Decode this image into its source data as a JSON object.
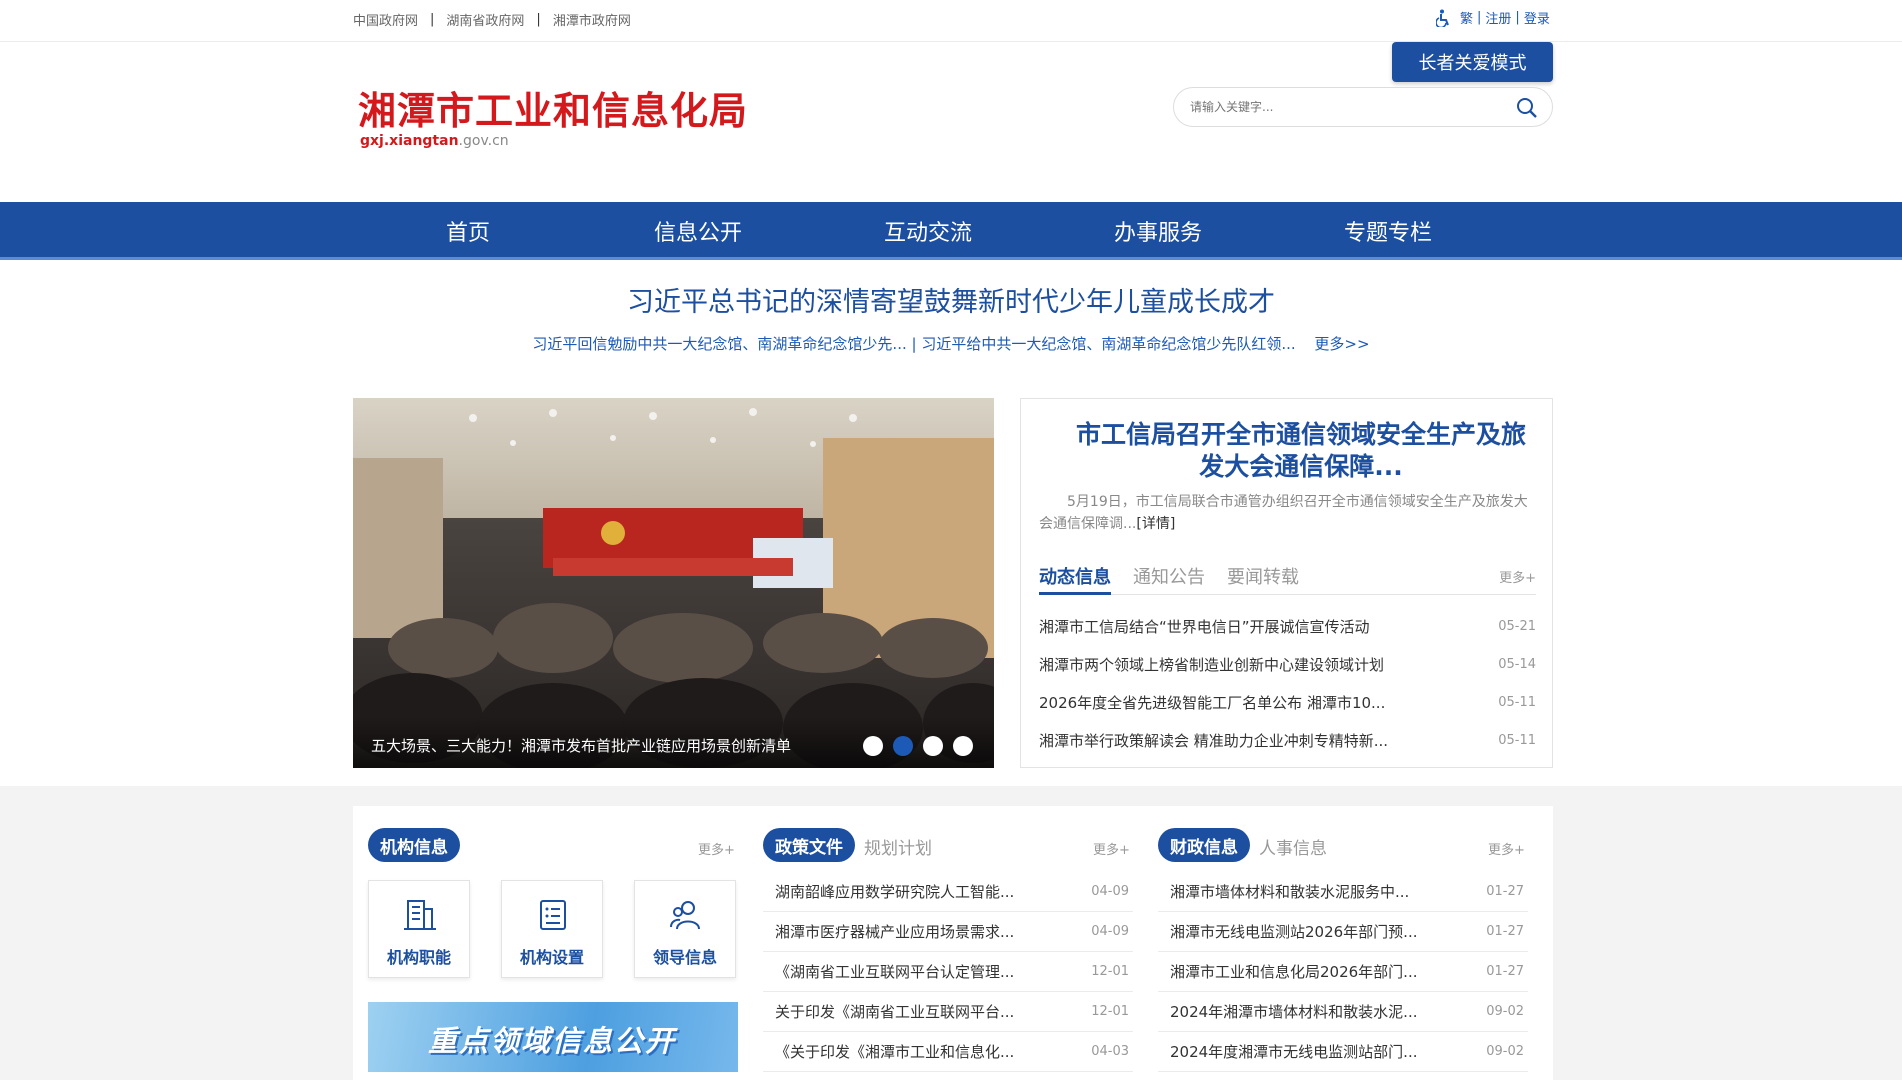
{
  "topbar": {
    "links": [
      "中国政府网",
      "湖南省政府网",
      "湘潭市政府网"
    ],
    "right_items": [
      "繁",
      "注册",
      "登录"
    ]
  },
  "header": {
    "elder_mode": "长者关爱模式",
    "title": "湘潭市工业和信息化局",
    "domain_bold": "gxj.xiangtan",
    "domain_rest": ".gov.cn",
    "search_placeholder": "请输入关键字..."
  },
  "nav": [
    "首页",
    "信息公开",
    "互动交流",
    "办事服务",
    "专题专栏"
  ],
  "headline": {
    "title": "习近平总书记的深情寄望鼓舞新时代少年儿童成长成才",
    "sub": "习近平回信勉励中共一大纪念馆、南湖革命纪念馆少先... | 习近平给中共一大纪念馆、南湖革命纪念馆少先队红领...",
    "more": "更多>>"
  },
  "slider": {
    "caption": "五大场景、三大能力！湘潭市发布首批产业链应用场景创新清单",
    "dots": 4,
    "active_dot": 1
  },
  "news": {
    "title": "市工信局召开全市通信领域安全生产及旅发大会通信保障...",
    "summary": "5月19日，市工信局联合市通管办组织召开全市通信领域安全生产及旅发大会通信保障调...",
    "detail": "[详情]",
    "tabs": [
      "动态信息",
      "通知公告",
      "要闻转载"
    ],
    "more": "更多+",
    "items": [
      {
        "title": "湘潭市工信局结合“世界电信日”开展诚信宣传活动",
        "date": "05-21"
      },
      {
        "title": "湘潭市两个领域上榜省制造业创新中心建设领域计划",
        "date": "05-14"
      },
      {
        "title": "2026年度全省先进级智能工厂名单公布 湘潭市10...",
        "date": "05-11"
      },
      {
        "title": "湘潭市举行政策解读会 精准助力企业冲刺专精特新...",
        "date": "05-11"
      }
    ]
  },
  "org": {
    "title": "机构信息",
    "more": "更多+",
    "cards": [
      "机构职能",
      "机构设置",
      "领导信息"
    ],
    "banner": "重点领域信息公开"
  },
  "policy": {
    "title": "政策文件",
    "alt": "规划计划",
    "more": "更多+",
    "items": [
      {
        "title": "湖南韶峰应用数学研究院人工智能...",
        "date": "04-09"
      },
      {
        "title": "湘潭市医疗器械产业应用场景需求...",
        "date": "04-09"
      },
      {
        "title": "《湖南省工业互联网平台认定管理...",
        "date": "12-01"
      },
      {
        "title": "关于印发《湖南省工业互联网平台...",
        "date": "12-01"
      },
      {
        "title": "《关于印发《湘潭市工业和信息化...",
        "date": "04-03"
      }
    ]
  },
  "finance": {
    "title": "财政信息",
    "alt": "人事信息",
    "more": "更多+",
    "items": [
      {
        "title": "湘潭市墙体材料和散装水泥服务中...",
        "date": "01-27"
      },
      {
        "title": "湘潭市无线电监测站2026年部门预...",
        "date": "01-27"
      },
      {
        "title": "湘潭市工业和信息化局2026年部门...",
        "date": "01-27"
      },
      {
        "title": "2024年湘潭市墙体材料和散装水泥...",
        "date": "09-02"
      },
      {
        "title": "2024年度湘潭市无线电监测站部门...",
        "date": "09-02"
      }
    ]
  }
}
